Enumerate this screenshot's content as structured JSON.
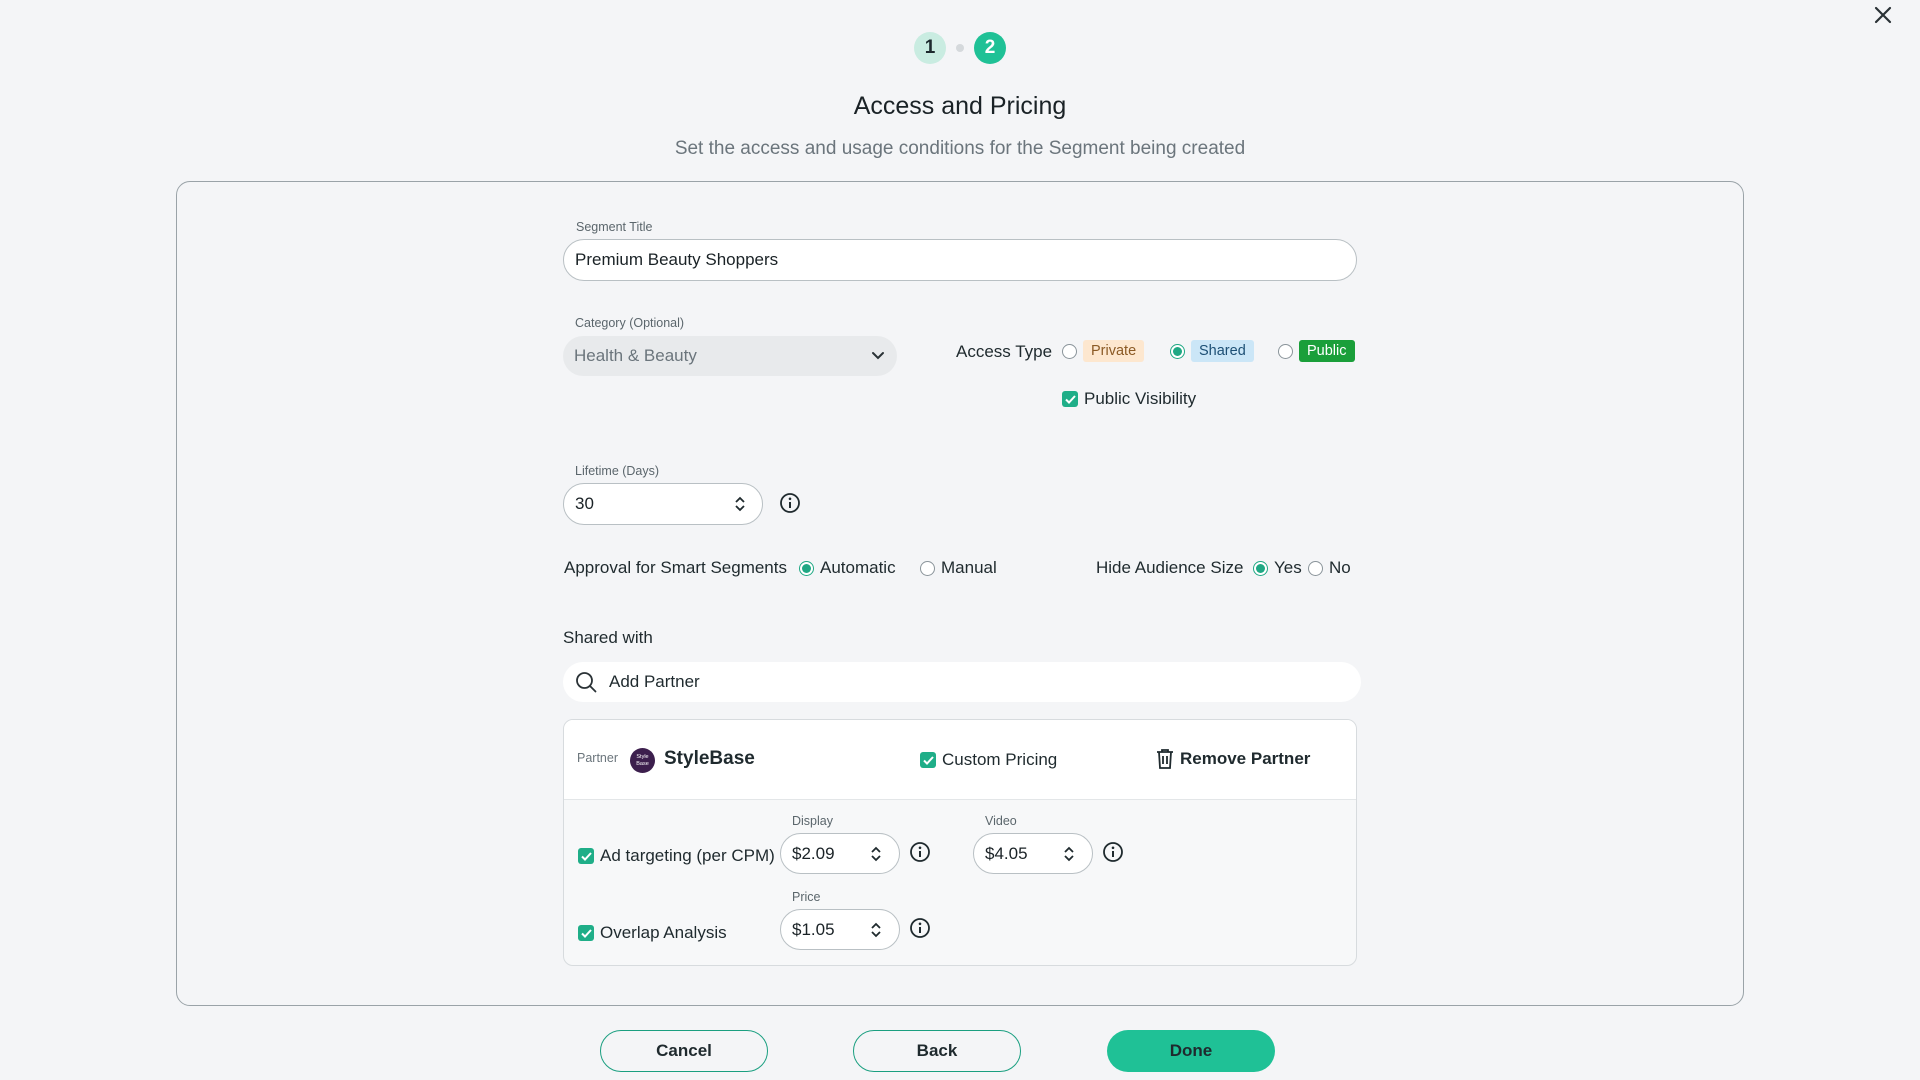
{
  "stepper": {
    "steps": [
      "1",
      "2"
    ],
    "active": 2
  },
  "header": {
    "title": "Access and Pricing",
    "subtitle": "Set the access and usage conditions for the Segment being created"
  },
  "form": {
    "segment_title": {
      "label": "Segment Title",
      "value": "Premium Beauty Shoppers"
    },
    "category": {
      "label": "Category (Optional)",
      "value": "Health & Beauty"
    },
    "access_type": {
      "label": "Access Type",
      "options": [
        "Private",
        "Shared",
        "Public"
      ],
      "selected": "Shared"
    },
    "public_visibility": {
      "label": "Public Visibility",
      "checked": true
    },
    "lifetime": {
      "label": "Lifetime (Days)",
      "value": "30"
    },
    "approval": {
      "label": "Approval for Smart Segments",
      "options": [
        "Automatic",
        "Manual"
      ],
      "selected": "Automatic"
    },
    "hide_audience": {
      "label": "Hide Audience Size",
      "options": [
        "Yes",
        "No"
      ],
      "selected": "Yes"
    },
    "shared_with": {
      "label": "Shared with",
      "placeholder": "Add Partner"
    }
  },
  "partner": {
    "tag": "Partner",
    "name": "StyleBase",
    "logo_text": "Style Base",
    "custom_pricing": {
      "label": "Custom Pricing",
      "checked": true
    },
    "remove_label": "Remove Partner",
    "ad_targeting": {
      "label": "Ad targeting (per CPM)",
      "checked": true,
      "display": {
        "label": "Display",
        "value": "$2.09"
      },
      "video": {
        "label": "Video",
        "value": "$4.05"
      }
    },
    "overlap": {
      "label": "Overlap Analysis",
      "checked": true,
      "price": {
        "label": "Price",
        "value": "$1.05"
      }
    }
  },
  "buttons": {
    "cancel": "Cancel",
    "back": "Back",
    "done": "Done"
  },
  "colors": {
    "accent": "#1fc196",
    "public_badge": "#1a9f3a",
    "shared_badge": "#cbe6f7",
    "private_badge": "#fde7cf"
  },
  "icons": [
    "close-icon",
    "search-icon",
    "info-icon",
    "trash-icon",
    "chevron-down-icon",
    "spinner-arrows-icon",
    "check-icon"
  ]
}
